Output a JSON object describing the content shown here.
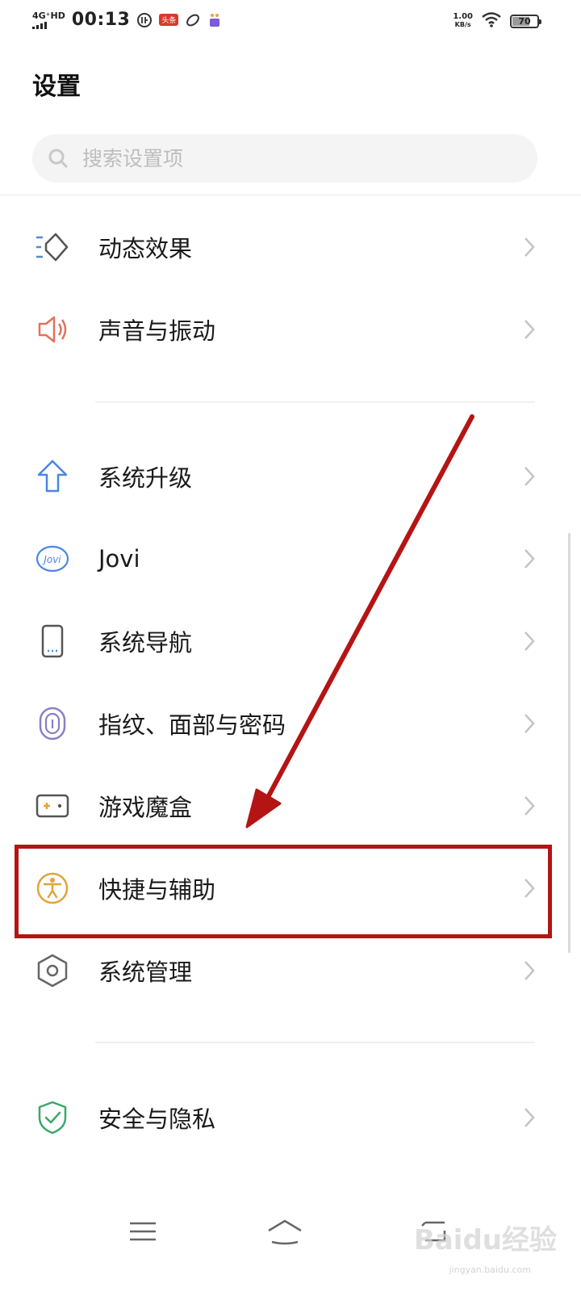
{
  "status_bar": {
    "network": "4G⁺HD",
    "time": "00:13",
    "notif_badge": "头条",
    "net_speed_value": "1.00",
    "net_speed_unit": "KB/s",
    "battery_level": "70",
    "battery_fraction": 0.7
  },
  "header": {
    "title": "设置"
  },
  "search": {
    "placeholder": "搜索设置项"
  },
  "settings": [
    {
      "label": "动态效果",
      "icon": "motion-effect-icon",
      "color": "#5a86d6"
    },
    {
      "label": "声音与振动",
      "icon": "speaker-icon",
      "color": "#e2725b"
    },
    {
      "label": "系统升级",
      "icon": "upgrade-arrow-icon",
      "color": "#4a86e8"
    },
    {
      "label": "Jovi",
      "icon": "jovi-icon",
      "color": "#4a86e8"
    },
    {
      "label": "系统导航",
      "icon": "phone-icon",
      "color": "#555555"
    },
    {
      "label": "指纹、面部与密码",
      "icon": "fingerprint-icon",
      "color": "#8a7fc8"
    },
    {
      "label": "游戏魔盒",
      "icon": "gamepad-icon",
      "color": "#555555"
    },
    {
      "label": "快捷与辅助",
      "icon": "accessibility-icon",
      "color": "#e0a43a"
    },
    {
      "label": "系统管理",
      "icon": "hexagon-gear-icon",
      "color": "#666666"
    },
    {
      "label": "安全与隐私",
      "icon": "shield-check-icon",
      "color": "#3aa86b"
    }
  ],
  "annotation": {
    "highlight_color": "#b51414"
  },
  "watermark": {
    "text": "Baidu经验",
    "sub": "jingyan.baidu.com"
  }
}
